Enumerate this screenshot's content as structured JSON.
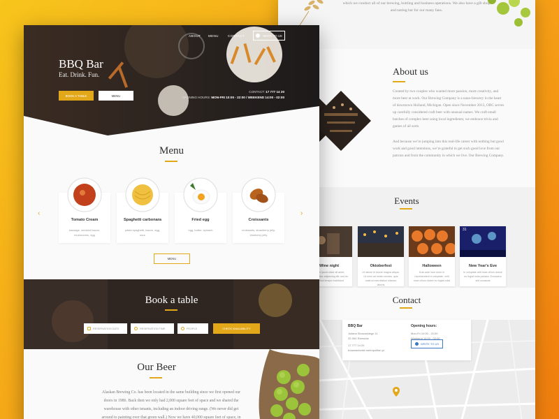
{
  "nav": {
    "about": "ABOUT",
    "menu": "MENU",
    "contact": "CONTACT",
    "write": "WRITE TO US"
  },
  "hero": {
    "brand": "BBQ Bar",
    "tagline": "Eat. Drink. Fun.",
    "btn_book": "BOOK A TABLE",
    "btn_menu": "MENU",
    "contact_label": "CONTACT:",
    "contact_phone": "17 777 14 20",
    "hours_label": "OPENING HOURS:",
    "hours": "MON-FRI 10:00 - 22:00 / WEEKEND 14:00 - 02:00"
  },
  "menu": {
    "title": "Menu",
    "button": "MENU",
    "prev": "‹",
    "next": "›",
    "items": [
      {
        "name": "Tomato Cream",
        "desc": "sausage, smoked bacon, mushrooms, egg"
      },
      {
        "name": "Spaghetti carbonara",
        "desc": "pasta spaghetti, bacon, egg, sour"
      },
      {
        "name": "Fried egg",
        "desc": "egg, butter, spinach"
      },
      {
        "name": "Croissants",
        "desc": "croissants, strawberry jelly, blueberry jelly"
      }
    ]
  },
  "book": {
    "title": "Book a table",
    "date": "RESERVATION DATE",
    "time": "RESERVATION TIME",
    "people": "PEOPLE",
    "check": "CHECK AVAILABILITY"
  },
  "beer": {
    "title": "Our Beer",
    "text": "Alaskan Brewing Co. has been located in the same building since we first opened our doors in 1986. Back then we only had 2,000 square feet of space and we shared the warehouse with other tenants, including an indoor driving range. (We never did get around to painting over that green wall.) Now we have 40,000 square feet of space, in"
  },
  "right_top": {
    "text": "which we conduct all of our brewing, bottling and business operations. We also have a gift shop and tasting bar for our many fans."
  },
  "about": {
    "title": "About us",
    "p1": "Created by two couples who wanted more passion, more creativity, and more beer at work. Our Brewing Company is a nano-brewery in the heart of downtown Holland, Michigan. Open since November 2013, OBC serves up carefully considered craft beer with unusual names. We craft small batches of complex beer using local ingredients; we embrace trivia and games of all sorts.",
    "p2": "And because we’re jumping into this real-life career with nothing but good work and good intentions, we’re grateful to get such good love from our patrons and from the community in which we live. Our Brewing Company."
  },
  "events": {
    "title": "Events",
    "items": [
      {
        "name": "Wine night",
        "date": "",
        "text": "Lorem ipsum dolor sit amet, consectetur adipiscing elit, sed do eiusmod tempor incididunt"
      },
      {
        "name": "Oktoberfest",
        "date": "",
        "text": "Ut labore et dolore magna aliqua. Ut enim ad minim veniam, quis nostrud exercitation ullamco laboris"
      },
      {
        "name": "Halloween",
        "date": "",
        "text": "Duis aute irure dolor in reprehenderit in voluptate, velit esse cillum dolore eu fugiat nulla"
      },
      {
        "name": "New Year's Eve",
        "date": "31",
        "text": "In voluptate velit esse cillum dolore eu fugiat nulla pariatur. Excepteur sint occaecat"
      }
    ]
  },
  "contact": {
    "title": "Contact",
    "name": "BBQ Bar",
    "street": "Juliana Skowackiego 11",
    "city": "32-064 Rzeszów",
    "phone": "17 777 14 20",
    "email": "bowarachelsit.metropolitan.pl",
    "hours_head": "Opening hours:",
    "weekday": "Mon-Fri 10:00 - 22:00",
    "weekend": "Weekend 14:00 - 02:00",
    "write": "WRITE TO US"
  },
  "colors": {
    "accent": "#e3a81a",
    "link_blue": "#3a78c8",
    "dark_text": "#2c2c2c"
  }
}
